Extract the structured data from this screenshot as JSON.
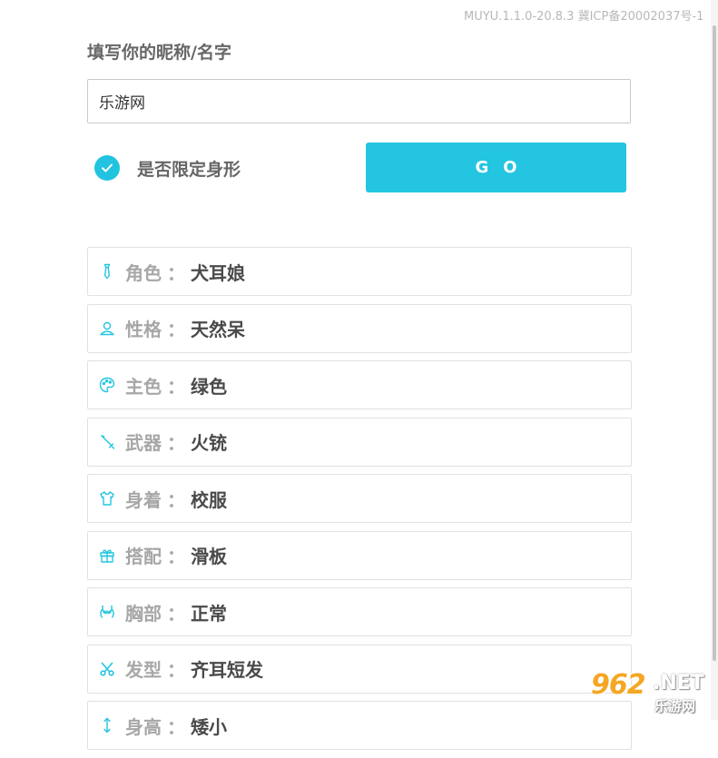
{
  "version_text": "MUYU.1.1.0-20.8.3 冀ICP备20002037号-1",
  "form": {
    "label": "填写你的昵称/名字",
    "name_value": "乐游网",
    "checkbox_label": "是否限定身形",
    "checkbox_checked": true,
    "go_label": "GO"
  },
  "attributes": [
    {
      "icon": "tie-icon",
      "label": "角色",
      "sep": "：",
      "value": "犬耳娘"
    },
    {
      "icon": "user-icon",
      "label": "性格",
      "sep": "：",
      "value": "天然呆"
    },
    {
      "icon": "palette-icon",
      "label": "主色",
      "sep": "：",
      "value": "绿色"
    },
    {
      "icon": "sword-icon",
      "label": "武器",
      "sep": "：",
      "value": "火铳"
    },
    {
      "icon": "shirt-icon",
      "label": "身着",
      "sep": "：",
      "value": "校服"
    },
    {
      "icon": "gift-icon",
      "label": "搭配",
      "sep": "：",
      "value": "滑板"
    },
    {
      "icon": "chest-icon",
      "label": "胸部",
      "sep": "：",
      "value": "正常"
    },
    {
      "icon": "scissors-icon",
      "label": "发型",
      "sep": "：",
      "value": "齐耳短发"
    },
    {
      "icon": "height-icon",
      "label": "身高",
      "sep": "：",
      "value": "矮小"
    }
  ],
  "watermark": {
    "number": "962",
    "domain": ".NET",
    "site_name": "乐游网"
  },
  "colors": {
    "accent": "#23c5e0",
    "icon": "#23c5e0"
  }
}
